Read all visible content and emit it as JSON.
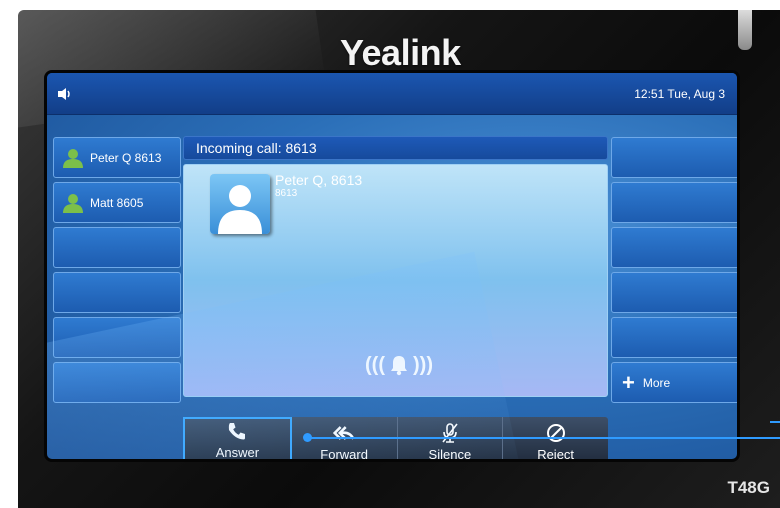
{
  "device": {
    "brand": "Yealink",
    "model": "T48G"
  },
  "status": {
    "time": "12:51 Tue, Aug 3",
    "speaker_icon": "speaker-icon"
  },
  "left_lines": [
    {
      "label": "Peter Q 8613",
      "icon": "contact-icon"
    },
    {
      "label": "Matt 8605",
      "icon": "contact-icon"
    },
    {
      "label": ""
    },
    {
      "label": ""
    },
    {
      "label": ""
    },
    {
      "label": ""
    }
  ],
  "right_lines": [
    {
      "label": ""
    },
    {
      "label": ""
    },
    {
      "label": ""
    },
    {
      "label": ""
    },
    {
      "label": ""
    },
    {
      "label": "More",
      "icon": "plus-icon"
    }
  ],
  "call": {
    "header": "Incoming call: 8613",
    "contact_name": "Peter Q, 8613",
    "contact_number": "8613"
  },
  "softkeys": [
    {
      "label": "Answer",
      "icon": "phone-icon"
    },
    {
      "label": "Forward",
      "icon": "forward-icon"
    },
    {
      "label": "Silence",
      "icon": "mute-icon"
    },
    {
      "label": "Reject",
      "icon": "reject-icon"
    }
  ],
  "colors": {
    "callout": "#2f9bff",
    "statusbar": "#1b56b0"
  }
}
